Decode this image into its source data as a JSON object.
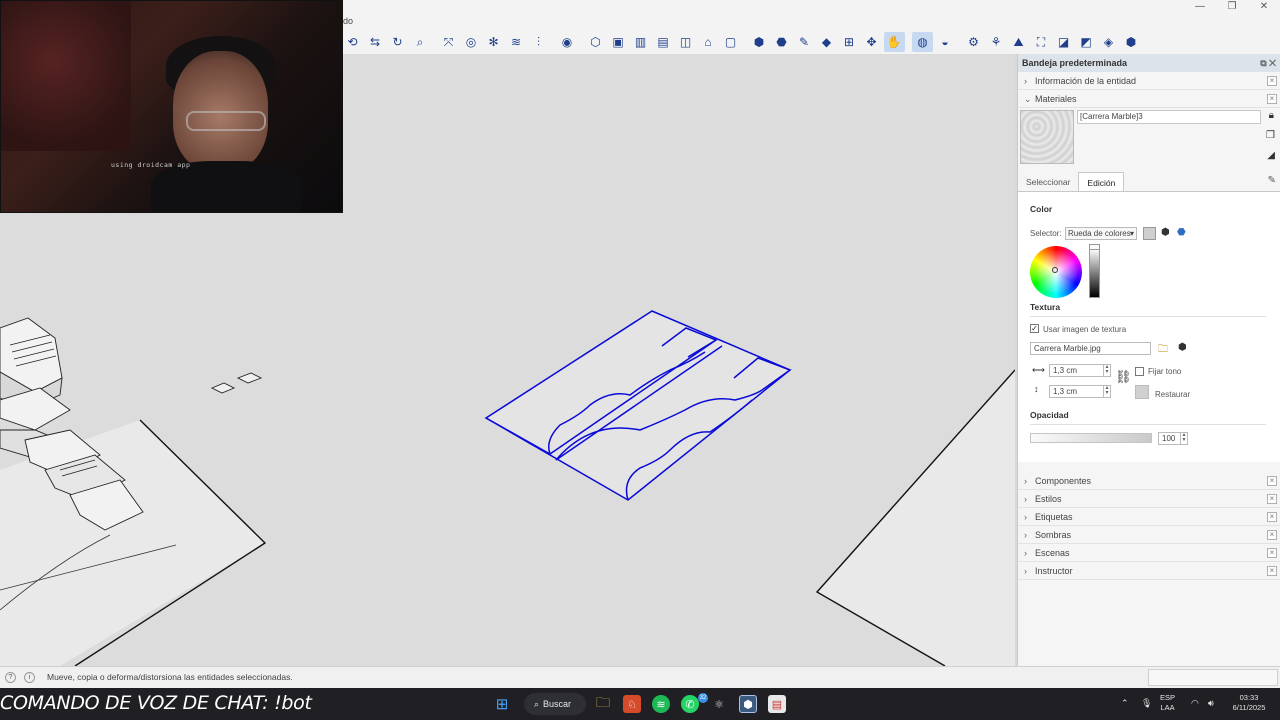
{
  "window": {
    "menu_fragment": "do",
    "controls": [
      "—",
      "❐",
      "✕"
    ]
  },
  "toolbar": {
    "icons": [
      {
        "name": "orbit-icon",
        "glyph": "⟲"
      },
      {
        "name": "flip-icon",
        "glyph": "⇆"
      },
      {
        "name": "rotate-icon",
        "glyph": "↻"
      },
      {
        "name": "zoom-icon",
        "glyph": "⌕"
      },
      {
        "name": "zoom-extents-icon",
        "glyph": "⤧"
      },
      {
        "name": "solid-tools-icon",
        "glyph": "◎"
      },
      {
        "name": "intersect-icon",
        "glyph": "✻"
      },
      {
        "name": "layers-icon",
        "glyph": "≋"
      },
      {
        "name": "trim-icon",
        "glyph": "⫶"
      },
      {
        "name": "view-iso-icon",
        "glyph": "◉"
      },
      {
        "name": "view-top-icon",
        "glyph": "⬡"
      },
      {
        "name": "view-front-icon",
        "glyph": "▣"
      },
      {
        "name": "view-right-icon",
        "glyph": "▥"
      },
      {
        "name": "view-back-icon",
        "glyph": "▤"
      },
      {
        "name": "view-left-icon",
        "glyph": "◫"
      },
      {
        "name": "section-icon",
        "glyph": "⌂"
      },
      {
        "name": "bounds-icon",
        "glyph": "▢"
      },
      {
        "name": "box-icon",
        "glyph": "⬢"
      },
      {
        "name": "box2-icon",
        "glyph": "⬣"
      },
      {
        "name": "paint-icon",
        "glyph": "✎"
      },
      {
        "name": "plane-icon",
        "glyph": "◆"
      },
      {
        "name": "grid-icon",
        "glyph": "⊞"
      },
      {
        "name": "move-icon",
        "glyph": "✥"
      },
      {
        "name": "hand-icon",
        "glyph": "✋"
      },
      {
        "name": "globe-icon",
        "glyph": "◍"
      },
      {
        "name": "globe2-icon",
        "glyph": "◒"
      },
      {
        "name": "network-icon",
        "glyph": "⚙"
      },
      {
        "name": "network2-icon",
        "glyph": "⚘"
      },
      {
        "name": "sandbox-icon",
        "glyph": "⛰"
      },
      {
        "name": "terrain-icon",
        "glyph": "⛶"
      },
      {
        "name": "terrain2-icon",
        "glyph": "◪"
      },
      {
        "name": "terrain3-icon",
        "glyph": "◩"
      },
      {
        "name": "terrain4-icon",
        "glyph": "◈"
      },
      {
        "name": "extension-icon",
        "glyph": "⬢"
      }
    ],
    "active": [
      "hand-icon",
      "globe-icon"
    ]
  },
  "webcam": {
    "overlay_text": "using droidcam app"
  },
  "tray": {
    "title": "Bandeja predeterminada",
    "entity_info": "Información de la entidad",
    "materials": "Materiales",
    "material_name": "[Carrera Marble]3",
    "tabs": [
      "Seleccionar",
      "Edición"
    ],
    "active_tab": "Edición",
    "color": {
      "heading": "Color",
      "selector_label": "Selector:",
      "selector_value": "Rueda de colores"
    },
    "texture": {
      "heading": "Textura",
      "use_image": "Usar imagen de textura",
      "file": "Carrera Marble.jpg",
      "width": "1,3 cm",
      "height": "1,3 cm",
      "fix_tone": "Fijar tono",
      "restore": "Restaurar"
    },
    "opacity": {
      "heading": "Opacidad",
      "value": "100"
    },
    "panels": [
      "Componentes",
      "Estilos",
      "Etiquetas",
      "Sombras",
      "Escenas",
      "Instructor"
    ]
  },
  "status": {
    "message": "Mueve, copia o deforma/distorsiona las entidades seleccionadas."
  },
  "taskbar": {
    "chat_command": "COMANDO DE VOZ DE CHAT: !bot",
    "search": "Buscar",
    "whatsapp_badge": "32",
    "lang": "ESP",
    "layout": "LAA",
    "time": "03:33",
    "date": "6/11/2025"
  },
  "colors": {
    "selection": "#0a0ad8",
    "accent": "#1f3f8c",
    "taskbar": "#1f1f24"
  }
}
